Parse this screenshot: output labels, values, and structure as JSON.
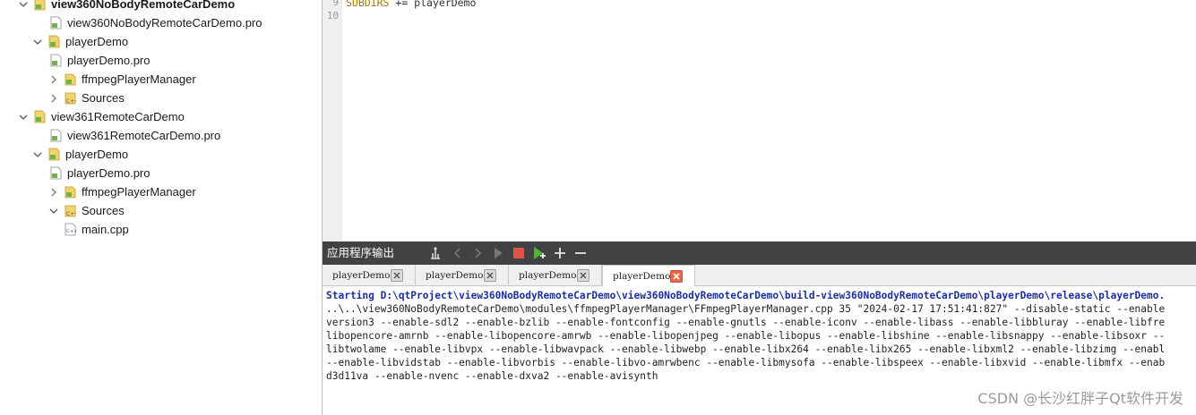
{
  "tree": {
    "rows": [
      {
        "label": "view360NoBodyRemoteCarDemo",
        "kind": "project",
        "expanded": true,
        "bold": true
      },
      {
        "label": "view360NoBodyRemoteCarDemo.pro",
        "kind": "pro-file"
      },
      {
        "label": "playerDemo",
        "kind": "subproject",
        "expanded": true
      },
      {
        "label": "playerDemo.pro",
        "kind": "pro-file"
      },
      {
        "label": "ffmpegPlayerManager",
        "kind": "folder",
        "expanded": false
      },
      {
        "label": "Sources",
        "kind": "sources-folder",
        "expanded": false
      },
      {
        "label": "view361RemoteCarDemo",
        "kind": "project",
        "expanded": true
      },
      {
        "label": "view361RemoteCarDemo.pro",
        "kind": "pro-file"
      },
      {
        "label": "playerDemo",
        "kind": "subproject",
        "expanded": true
      },
      {
        "label": "playerDemo.pro",
        "kind": "pro-file"
      },
      {
        "label": "ffmpegPlayerManager",
        "kind": "folder",
        "expanded": false
      },
      {
        "label": "Sources",
        "kind": "sources-folder",
        "expanded": true
      },
      {
        "label": "main.cpp",
        "kind": "cpp-file"
      }
    ]
  },
  "editor": {
    "lines": [
      {
        "number": "9",
        "code_keyword": "SUBDIRS",
        "code_rest": " += playerDemo"
      },
      {
        "number": "10",
        "code_keyword": "",
        "code_rest": ""
      }
    ]
  },
  "output": {
    "title": "应用程序输出",
    "tabs": [
      {
        "label": "playerDemo",
        "active": false
      },
      {
        "label": "playerDemo",
        "active": false
      },
      {
        "label": "playerDemo",
        "active": false
      },
      {
        "label": "playerDemo",
        "active": true
      }
    ],
    "lines": [
      {
        "text": "Starting D:\\qtProject\\view360NoBodyRemoteCarDemo\\view360NoBodyRemoteCarDemo\\build-view360NoBodyRemoteCarDemo\\playerDemo\\release\\playerDemo.",
        "style": "blue"
      },
      {
        "text": "..\\..\\view360NoBodyRemoteCarDemo\\modules\\ffmpegPlayerManager\\FFmpegPlayerManager.cpp 35 \"2024-02-17 17:51:41:827\" --disable-static --enable",
        "style": "normal"
      },
      {
        "text": "version3 --enable-sdl2 --enable-bzlib --enable-fontconfig --enable-gnutls --enable-iconv --enable-libass --enable-libbluray --enable-libfre",
        "style": "normal"
      },
      {
        "text": "libopencore-amrnb --enable-libopencore-amrwb --enable-libopenjpeg --enable-libopus --enable-libshine --enable-libsnappy --enable-libsoxr --",
        "style": "normal"
      },
      {
        "text": "libtwolame --enable-libvpx --enable-libwavpack --enable-libwebp --enable-libx264 --enable-libx265 --enable-libxml2 --enable-libzimg --enabl",
        "style": "normal"
      },
      {
        "text": "--enable-libvidstab --enable-libvorbis --enable-libvo-amrwbenc --enable-libmysofa --enable-libspeex --enable-libxvid --enable-libmfx --enab",
        "style": "normal"
      },
      {
        "text": "d3d11va --enable-nvenc --enable-dxva2 --enable-avisynth",
        "style": "normal"
      }
    ]
  },
  "watermark": "CSDN @长沙红胖子Qt软件开发",
  "colors": {
    "output_header_bg": "#404244",
    "starting_line": "#1c2fa0",
    "keyword": "#a37b00",
    "active_tab_close": "#e8664a"
  },
  "icons": {
    "toolbar": [
      "attach-debugger-icon",
      "previous-icon",
      "next-icon",
      "run-icon",
      "stop-icon",
      "rerun-icon",
      "zoom-in-icon",
      "zoom-out-icon"
    ]
  }
}
